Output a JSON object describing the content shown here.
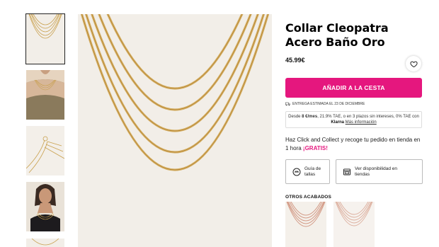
{
  "product": {
    "title_line1": "Collar Cleopatra",
    "title_line2": "Acero Baño Oro",
    "price": "45.99€",
    "add_to_cart": "AÑADIR A LA CESTA",
    "delivery": "ENTREGA ESTIMADA EL 23 DE DICIEMBRE"
  },
  "klarna": {
    "prefix": "Desde ",
    "amount": "8 €/mes",
    "middle": ", 21.9% TAE, o en 3 plazos sin intereses, 0% TAE con ",
    "brand": "Klarna",
    "more": "Más información"
  },
  "click_collect": {
    "text": "Haz Click and Collect y recoge tu pedido en tienda en 1 hora ",
    "highlight": "¡GRATIS!"
  },
  "options": {
    "size_guide_l1": "Guía de",
    "size_guide_l2": "tallas",
    "availability_l1": "Ver disponibilidad en",
    "availability_l2": "tiendas"
  },
  "finishes": {
    "heading": "OTROS ACABADOS"
  },
  "icons": {
    "wishlist": "heart-icon",
    "delivery": "truck-icon",
    "size_guide": "ruler-circle-icon",
    "stores": "store-icon"
  },
  "colors": {
    "accent": "#e5177e",
    "gold": "#c9a04d",
    "rose_gold": "#d39a86"
  }
}
